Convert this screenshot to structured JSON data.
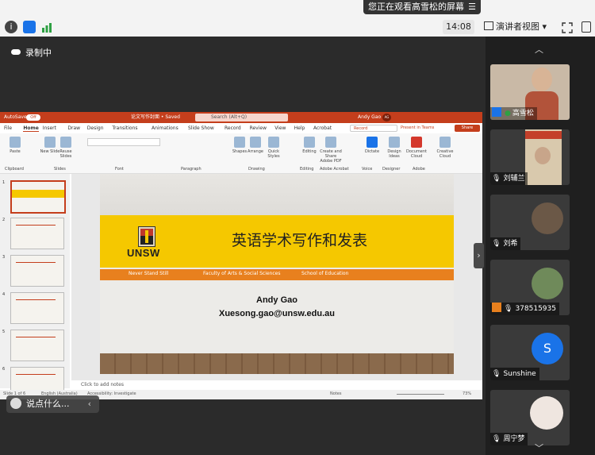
{
  "top": {
    "banner_text": "您正在观看高雪松的屏幕",
    "banner_menu": "☰",
    "time": "14:08",
    "presenter_view": "演讲者视图",
    "dropdown_arrow": "▾"
  },
  "recording": {
    "label": "录制中"
  },
  "ppt": {
    "autosave": "AutoSave",
    "autosave_state": "Off",
    "doc_title": "论文写作封面 • Saved",
    "search_placeholder": "Search (Alt+Q)",
    "user": "Andy Gao",
    "user_initials": "AG",
    "menu_tabs": [
      "File",
      "Home",
      "Insert",
      "Draw",
      "Design",
      "Transitions",
      "Animations",
      "Slide Show",
      "Record",
      "Review",
      "View",
      "Help",
      "Acrobat"
    ],
    "record_button": "Record",
    "present_button": "Present in Teams",
    "share_button": "Share",
    "ribbon_groups": [
      "Clipboard",
      "Slides",
      "Font",
      "Paragraph",
      "Drawing",
      "Editing",
      "Adobe Acrobat",
      "Voice",
      "Designer",
      "Adobe"
    ],
    "ribbon_buttons": [
      "Paste",
      "New Slide",
      "Reuse Slides",
      "Shapes",
      "Arrange",
      "Quick Styles",
      "Editing",
      "Create and Share Adobe PDF",
      "Dictate",
      "Design Ideas",
      "Document Cloud",
      "Creative Cloud"
    ],
    "thumb_numbers": [
      "1",
      "2",
      "3",
      "4",
      "5",
      "6"
    ],
    "notes_placeholder": "Click to add notes",
    "status_left": "Slide 1 of 6",
    "status_lang": "English (Australia)",
    "status_access": "Accessibility: Investigate",
    "status_notes": "Notes",
    "status_zoom": "73%"
  },
  "slide": {
    "logo_text": "UNSW",
    "title": "英语学术写作和发表",
    "tagline_items": [
      "Never Stand Still",
      "Faculty of Arts & Social Sciences",
      "School of Education"
    ],
    "author": "Andy Gao",
    "email": "Xuesong.gao@unsw.edu.au"
  },
  "comment": {
    "placeholder": "说点什么...",
    "arrow": "‹"
  },
  "participants": [
    {
      "name": "高雪松",
      "type": "video"
    },
    {
      "name": "刘辅兰",
      "type": "video"
    },
    {
      "name": "刘希",
      "type": "avatar"
    },
    {
      "name": "378515935",
      "type": "avatar"
    },
    {
      "name": "Sunshine",
      "type": "initial",
      "initial": "S"
    },
    {
      "name": "周宁梦",
      "type": "avatar"
    }
  ],
  "colors": {
    "ppt_red": "#c43e1c",
    "slide_yellow": "#f5c800",
    "slide_orange": "#e8801e",
    "accent_blue": "#1a73e8"
  }
}
